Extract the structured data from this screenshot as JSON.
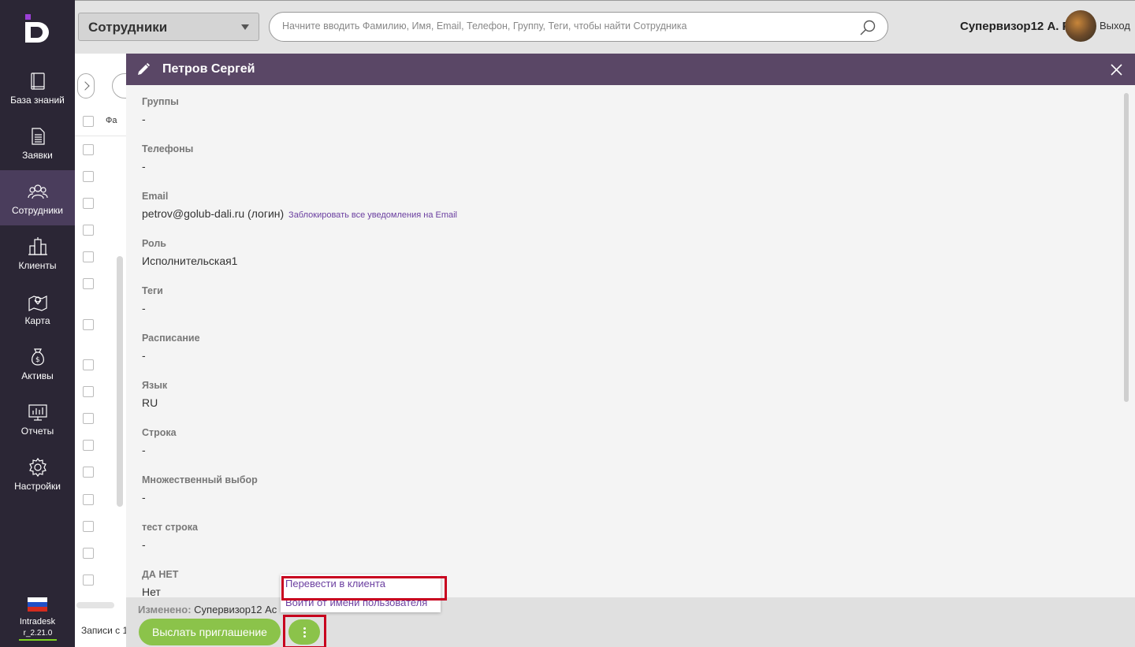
{
  "sidebar": {
    "items": [
      {
        "label": "База знаний",
        "icon": "book-icon"
      },
      {
        "label": "Заявки",
        "icon": "document-icon"
      },
      {
        "label": "Сотрудники",
        "icon": "people-icon",
        "active": true
      },
      {
        "label": "Клиенты",
        "icon": "buildings-icon"
      },
      {
        "label": "Карта",
        "icon": "map-icon"
      },
      {
        "label": "Активы",
        "icon": "money-bag-icon"
      },
      {
        "label": "Отчеты",
        "icon": "chart-icon"
      },
      {
        "label": "Настройки",
        "icon": "gear-icon"
      }
    ],
    "brand": "Intradesk",
    "version": "r_2.21.0",
    "language_flag": "ru-flag-icon"
  },
  "topbar": {
    "section": "Сотрудники",
    "search_placeholder": "Начните вводить Фамилию, Имя, Email, Телефон, Группу, Теги, чтобы найти Сотрудника",
    "user": "Супервизор12 А. Р.",
    "logout": "Выход"
  },
  "list": {
    "column_head": "Фа",
    "records_label": "Записи с 1"
  },
  "panel": {
    "title": "Петров Сергей",
    "fields": [
      {
        "label": "Группы",
        "value": "-"
      },
      {
        "label": "Телефоны",
        "value": "-"
      },
      {
        "label": "Email",
        "value": "petrov@golub-dali.ru (логин)",
        "link": "Заблокировать все уведомления на Email"
      },
      {
        "label": "Роль",
        "value": "Исполнительская1"
      },
      {
        "label": "Теги",
        "value": "-"
      },
      {
        "label": "Расписание",
        "value": "-"
      },
      {
        "label": "Язык",
        "value": "RU"
      },
      {
        "label": "Строка",
        "value": "-"
      },
      {
        "label": "Множественный выбор",
        "value": "-"
      },
      {
        "label": "тест строка",
        "value": "-"
      },
      {
        "label": "ДА НЕТ",
        "value": "Нет"
      }
    ],
    "changed_label": "Изменено:",
    "changed_value": "Супервизор12 Ас",
    "invite_button": "Выслать приглашение",
    "menu": [
      "Перевести в клиента",
      "Войти от имени пользователя"
    ]
  },
  "colors": {
    "sidebar_bg": "#2b2635",
    "sidebar_active": "#4a3d5c",
    "header_bg": "#5a4766",
    "accent_green": "#8bc34a",
    "link_purple": "#6b3fa0",
    "highlight_red": "#c8001e"
  }
}
